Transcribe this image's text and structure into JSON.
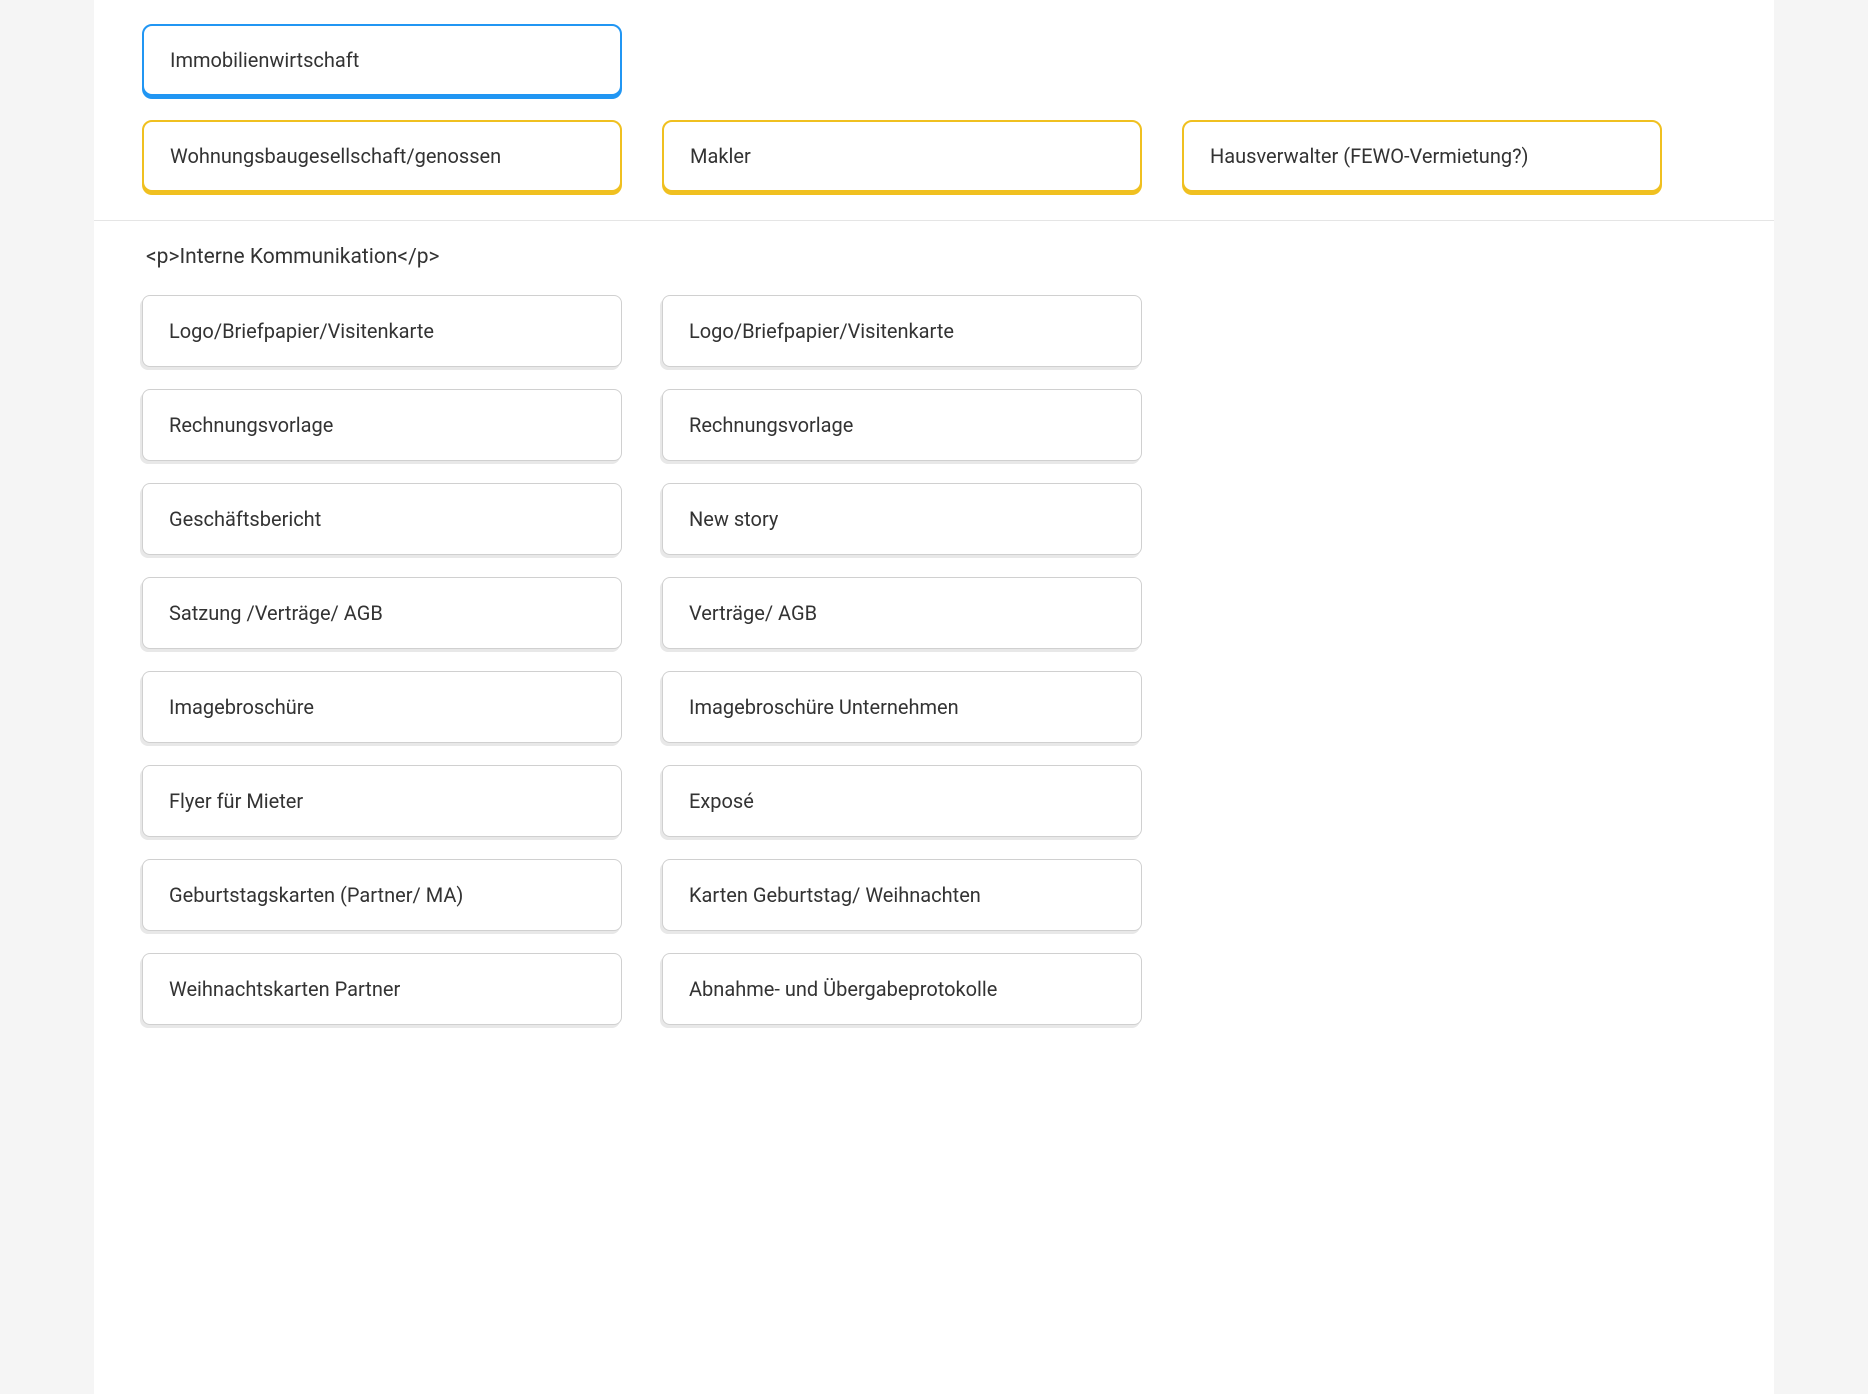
{
  "top": {
    "parent": {
      "label": "Immobilienwirtschaft"
    },
    "children": [
      {
        "label": "Wohnungsbaugesellschaft/genossen"
      },
      {
        "label": "Makler"
      },
      {
        "label": "Hausverwalter (FEWO-Vermietung?)"
      }
    ]
  },
  "bottom": {
    "heading": "<p>Interne Kommunikation</p>",
    "columns": {
      "left": [
        "Logo/Briefpapier/Visitenkarte",
        "Rechnungsvorlage",
        "Geschäftsbericht",
        "Satzung /Verträge/ AGB",
        "Imagebroschüre",
        "Flyer für Mieter",
        "Geburtstagskarten (Partner/ MA)",
        "Weihnachtskarten Partner"
      ],
      "right": [
        "Logo/Briefpapier/Visitenkarte",
        "Rechnungsvorlage",
        "New story",
        "Verträge/ AGB",
        "Imagebroschüre Unternehmen",
        "Exposé",
        "Karten Geburtstag/ Weihnachten",
        "Abnahme- und Übergabeprotokolle"
      ]
    },
    "placeholder_index_right": 2
  }
}
